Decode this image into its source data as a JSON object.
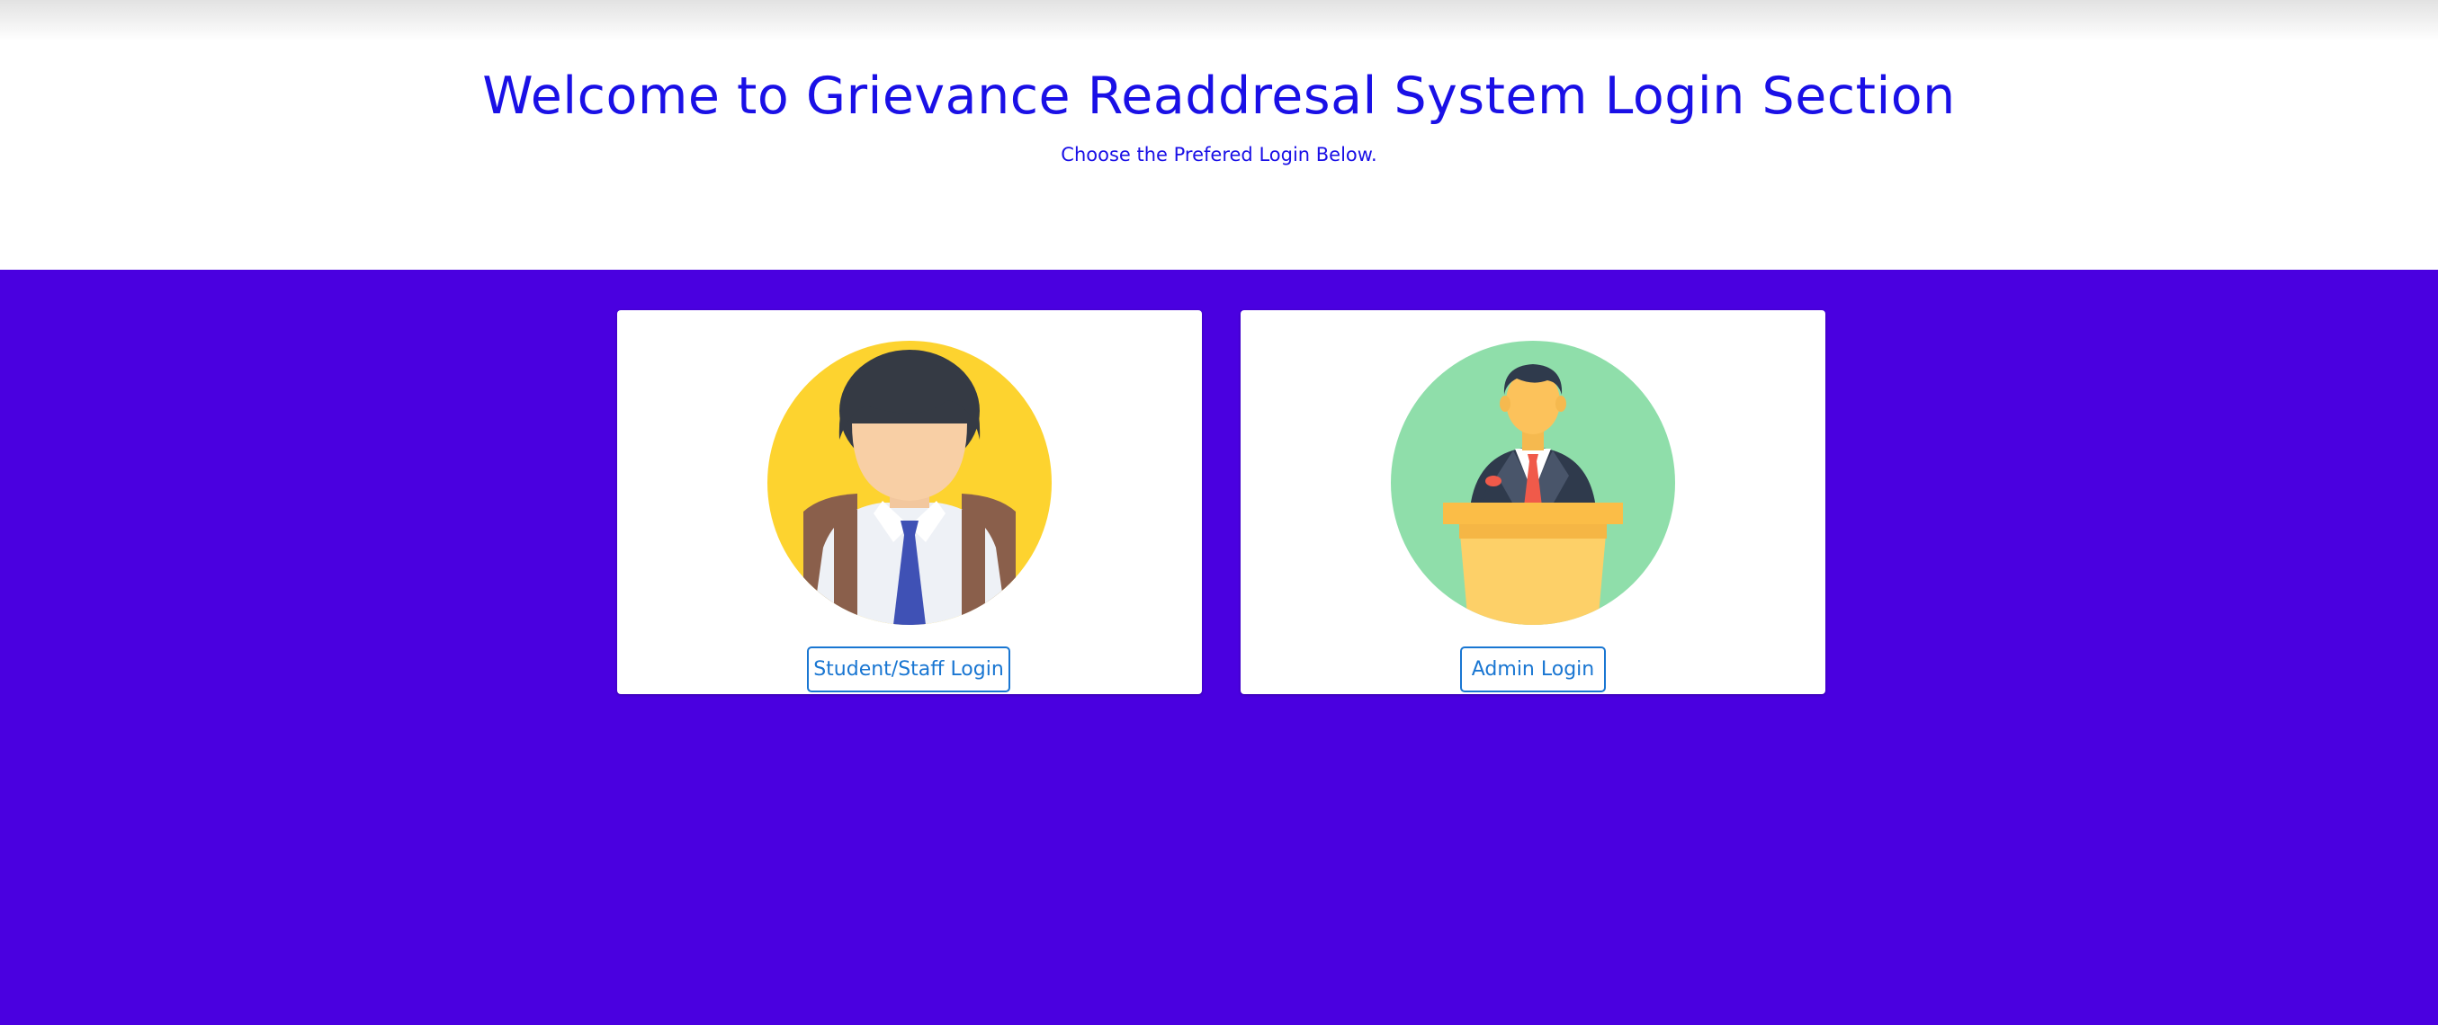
{
  "header": {
    "title": "Welcome to Grievance Readdresal System Login Section",
    "subtitle": "Choose the Prefered Login Below."
  },
  "cards": [
    {
      "icon": "student-avatar-icon",
      "button_label": "Student/Staff Login"
    },
    {
      "icon": "admin-speaker-icon",
      "button_label": "Admin Login"
    }
  ],
  "colors": {
    "title_text": "#1a10e6",
    "band_background": "#4a00e0",
    "button_border": "#1976d2",
    "student_circle": "#fdd32f",
    "admin_circle": "#8fdeaa"
  }
}
